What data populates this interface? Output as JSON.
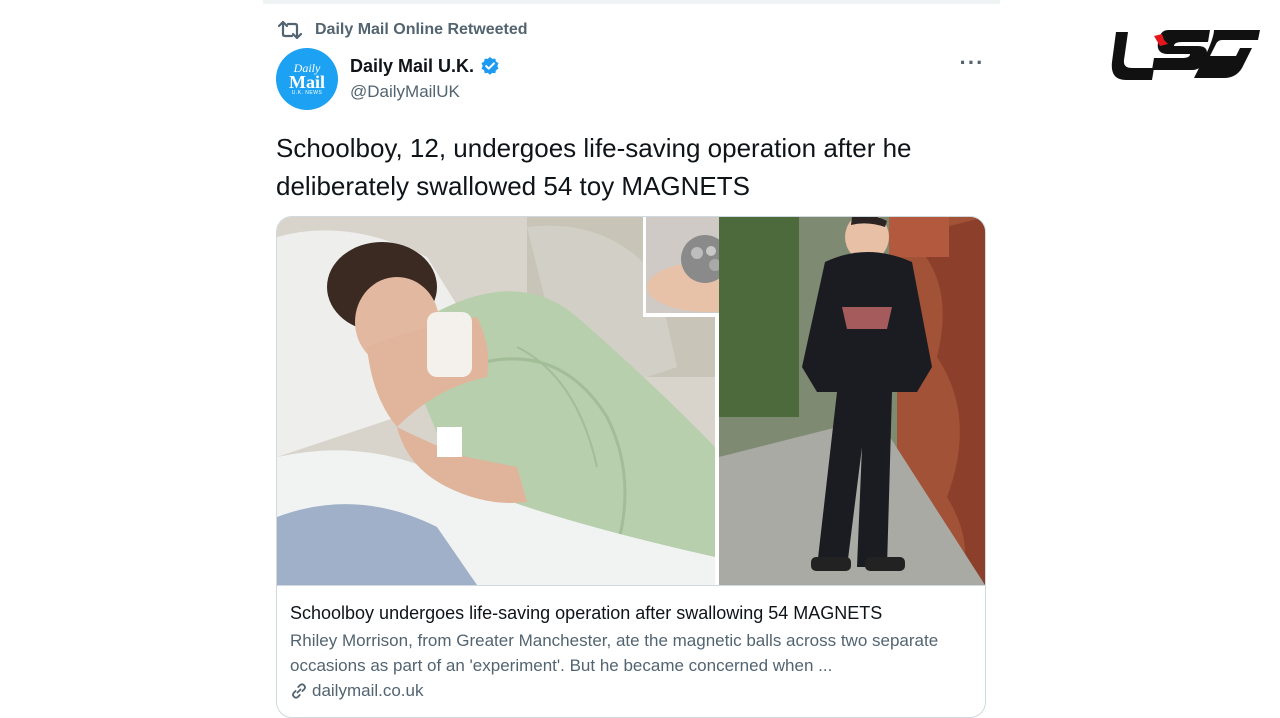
{
  "retweet": {
    "text": "Daily Mail Online Retweeted",
    "icon": "retweet-icon"
  },
  "author": {
    "avatar": {
      "line1": "Daily",
      "line2": "Mail",
      "line3": "U.K. NEWS"
    },
    "name": "Daily Mail U.K.",
    "handle": "@DailyMailUK",
    "verified_icon": "verified-badge-icon"
  },
  "more_icon": "more-options-icon",
  "more_label": "···",
  "tweet": {
    "text": "Schoolboy, 12, undergoes life-saving operation after he deliberately swallowed 54 toy MAGNETS"
  },
  "card": {
    "title": "Schoolboy undergoes life-saving operation after swallowing 54 MAGNETS",
    "description": "Rhiley Morrison, from Greater Manchester, ate the magnetic balls across two separate occasions as part of an 'experiment'. But he became concerned when ...",
    "domain": "dailymail.co.uk",
    "link_icon": "link-icon",
    "image_alt": "boy in hospital bed, magnetic balls in hand, boy standing outside in black hoodie"
  },
  "brand_logo": {
    "icon": "site-logo"
  },
  "colors": {
    "text_primary": "#0f1419",
    "text_secondary": "#536471",
    "verified_blue": "#1d9bf0",
    "avatar_blue": "#1da1f2",
    "border": "#cfd9de",
    "logo_black": "#111111",
    "logo_red": "#e4161c"
  }
}
